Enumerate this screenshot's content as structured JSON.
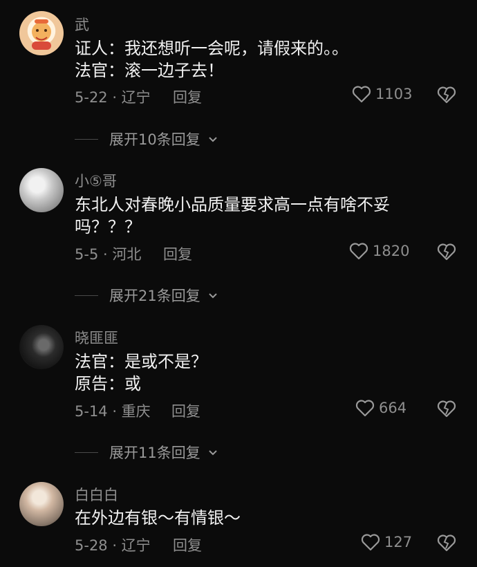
{
  "comments": [
    {
      "username": "武",
      "lines": [
        "证人：我还想听一会呢，请假来的。。",
        "法官：滚一边子去！"
      ],
      "date_location": "5-22 · 辽宁",
      "reply_label": "回复",
      "likes": "1103",
      "expand_label": "展开10条回复"
    },
    {
      "username": "小⑤哥",
      "lines": [
        "东北人对春晚小品质量要求高一点有啥不妥",
        "吗？？？"
      ],
      "date_location": "5-5 · 河北",
      "reply_label": "回复",
      "likes": "1820",
      "expand_label": "展开21条回复"
    },
    {
      "username": "晓匪匪",
      "lines": [
        "法官：是或不是？",
        "原告：或"
      ],
      "date_location": "5-14 · 重庆",
      "reply_label": "回复",
      "likes": "664",
      "expand_label": "展开11条回复"
    },
    {
      "username": "白白白",
      "lines": [
        "在外边有银～有情银～"
      ],
      "date_location": "5-28 · 辽宁",
      "reply_label": "回复",
      "likes": "127"
    }
  ],
  "icons": {
    "like": "heart-outline-icon",
    "dislike": "broken-heart-icon",
    "expand": "chevron-down-icon"
  },
  "colors": {
    "background": "#0b0b0b",
    "text_primary": "#f1f1f1",
    "text_secondary": "#8f8f8f"
  }
}
